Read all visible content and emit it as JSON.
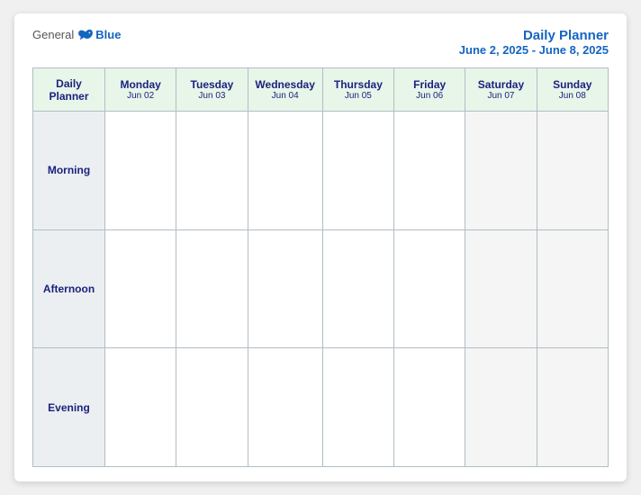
{
  "header": {
    "logo": {
      "general": "General",
      "blue": "Blue",
      "bird_label": "bird-logo"
    },
    "title": "Daily Planner",
    "subtitle": "June 2, 2025 - June 8, 2025"
  },
  "columns": [
    {
      "id": "daily-planner-col",
      "name": "Daily",
      "name2": "Planner",
      "date": ""
    },
    {
      "id": "monday",
      "name": "Monday",
      "date": "Jun 02"
    },
    {
      "id": "tuesday",
      "name": "Tuesday",
      "date": "Jun 03"
    },
    {
      "id": "wednesday",
      "name": "Wednesday",
      "date": "Jun 04"
    },
    {
      "id": "thursday",
      "name": "Thursday",
      "date": "Jun 05"
    },
    {
      "id": "friday",
      "name": "Friday",
      "date": "Jun 06"
    },
    {
      "id": "saturday",
      "name": "Saturday",
      "date": "Jun 07"
    },
    {
      "id": "sunday",
      "name": "Sunday",
      "date": "Jun 08"
    }
  ],
  "rows": [
    {
      "id": "morning",
      "label": "Morning"
    },
    {
      "id": "afternoon",
      "label": "Afternoon"
    },
    {
      "id": "evening",
      "label": "Evening"
    }
  ]
}
